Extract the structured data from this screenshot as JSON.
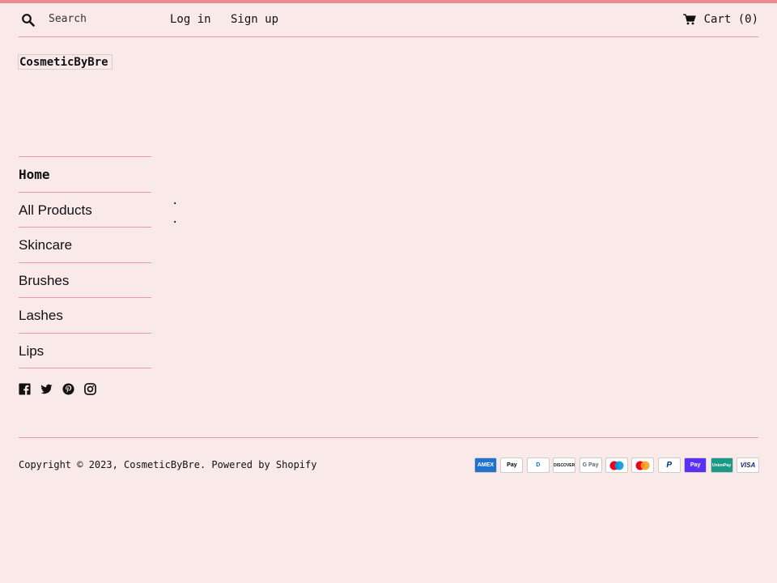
{
  "header": {
    "search_placeholder": "Search",
    "login_label": "Log in",
    "signup_label": "Sign up",
    "cart_label": "Cart (0)"
  },
  "logo": {
    "text": "CosmeticByBre"
  },
  "nav": {
    "items": [
      {
        "label": "Home",
        "active": true
      },
      {
        "label": "All Products"
      },
      {
        "label": "Skincare"
      },
      {
        "label": "Brushes"
      },
      {
        "label": "Lashes"
      },
      {
        "label": "Lips"
      }
    ]
  },
  "social": [
    "facebook-icon",
    "twitter-icon",
    "pinterest-icon",
    "instagram-icon"
  ],
  "main": {
    "dot1": ".",
    "dot2": "."
  },
  "footer": {
    "copyright_prefix": "Copyright © 2023, ",
    "brand": "CosmeticByBre",
    "powered_by": "Powered by Shopify"
  },
  "payments": [
    {
      "name": "AMEX",
      "bg": "#1f72cd",
      "fg": "#ffffff"
    },
    {
      "name": "Pay",
      "bg": "#ffffff",
      "fg": "#000000"
    },
    {
      "name": "D",
      "bg": "#ffffff",
      "fg": "#0079be"
    },
    {
      "name": "DISCOVER",
      "bg": "#ffffff",
      "fg": "#111111"
    },
    {
      "name": "G Pay",
      "bg": "#ffffff",
      "fg": "#5f6368"
    },
    {
      "name": "maestro",
      "bg": "#ffffff",
      "fg": "#111111"
    },
    {
      "name": "mastercard",
      "bg": "#ffffff",
      "fg": "#111111"
    },
    {
      "name": "P",
      "bg": "#ffffff",
      "fg": "#003087"
    },
    {
      "name": "Pay",
      "bg": "#5a31f4",
      "fg": "#ffffff"
    },
    {
      "name": "UnionPay",
      "bg": "#1a9a86",
      "fg": "#ffffff"
    },
    {
      "name": "VISA",
      "bg": "#ffffff",
      "fg": "#1a1f71"
    }
  ],
  "colors": {
    "background": "#f9e9e9",
    "accent": "#ea8a93",
    "divider": "#e59aa1"
  }
}
